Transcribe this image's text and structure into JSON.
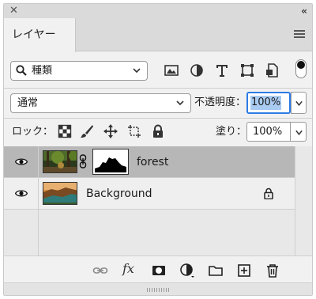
{
  "panel": {
    "tab_label": "レイヤー"
  },
  "filter": {
    "label": "種類",
    "icons": [
      "image-filter-icon",
      "adjustment-filter-icon",
      "type-filter-icon",
      "shape-filter-icon",
      "smart-object-filter-icon"
    ],
    "toggle": "on"
  },
  "blend": {
    "mode": "通常",
    "opacity_label": "不透明度：",
    "opacity_value": "100%"
  },
  "lock": {
    "label": "ロック：",
    "icons": [
      "lock-transparent-pixels-icon",
      "lock-image-pixels-icon",
      "lock-position-icon",
      "prevent-autonest-icon",
      "lock-all-icon"
    ],
    "fill_label": "塗り：",
    "fill_value": "100%"
  },
  "layers": [
    {
      "name": "forest",
      "visible": true,
      "selected": true,
      "has_mask": true,
      "locked": false
    },
    {
      "name": "Background",
      "visible": true,
      "selected": false,
      "has_mask": false,
      "locked": true
    }
  ],
  "bottom_icons": [
    "link-layers-icon",
    "fx-icon",
    "add-mask-icon",
    "adjustment-layer-icon",
    "new-group-icon",
    "new-layer-icon",
    "delete-layer-icon"
  ],
  "fx_label": "fx"
}
